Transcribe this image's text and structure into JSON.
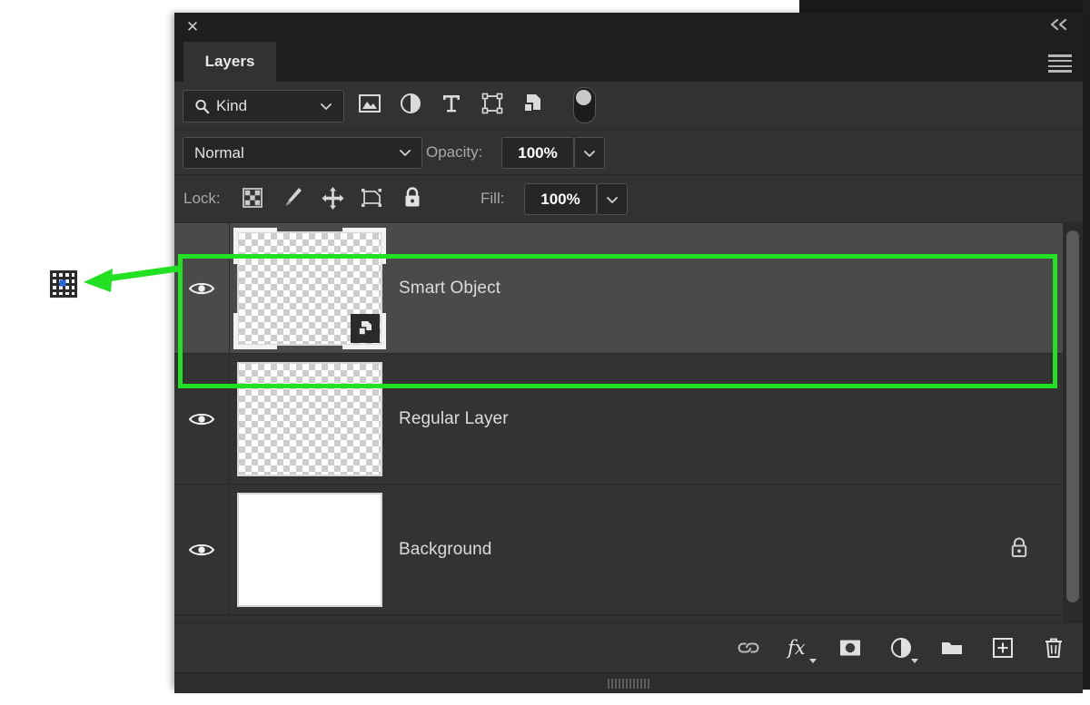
{
  "panel": {
    "title": "Layers",
    "close_label": "✕",
    "collapse_label": "«",
    "menu_icon": "hamburger-menu-icon"
  },
  "filter": {
    "kind_label": "Kind",
    "search_icon": "search-icon",
    "caret_icon": "chevron-down-icon",
    "icons": [
      {
        "name": "filter-pixel-layers-icon",
        "title": "Pixel Layers"
      },
      {
        "name": "filter-adjustment-layers-icon",
        "title": "Adjustment Layers"
      },
      {
        "name": "filter-type-layers-icon",
        "title": "Type Layers"
      },
      {
        "name": "filter-shape-layers-icon",
        "title": "Shape Layers"
      },
      {
        "name": "filter-smart-object-layers-icon",
        "title": "Smart Objects"
      }
    ],
    "toggle_name": "filter-enable-toggle"
  },
  "blend": {
    "mode": "Normal",
    "opacity_label": "Opacity:",
    "opacity_value": "100%",
    "caret_icon": "chevron-down-icon"
  },
  "lock": {
    "label": "Lock:",
    "fill_label": "Fill:",
    "fill_value": "100%",
    "icons": [
      {
        "name": "lock-transparent-pixels-icon"
      },
      {
        "name": "lock-image-pixels-icon"
      },
      {
        "name": "lock-position-icon"
      },
      {
        "name": "lock-artboard-nesting-icon"
      },
      {
        "name": "lock-all-icon"
      }
    ]
  },
  "layers": [
    {
      "name": "Smart Object",
      "visible": true,
      "selected": true,
      "thumb": "checker",
      "badge": "smart-object-badge-icon",
      "locked": false
    },
    {
      "name": "Regular Layer",
      "visible": true,
      "selected": false,
      "thumb": "checker",
      "badge": null,
      "locked": false
    },
    {
      "name": "Background",
      "visible": true,
      "selected": false,
      "thumb": "white",
      "badge": null,
      "locked": true
    }
  ],
  "bottom_toolbar": [
    {
      "name": "link-layers-icon",
      "has_caret": false
    },
    {
      "name": "layer-style-fx-icon",
      "has_caret": true
    },
    {
      "name": "add-layer-mask-icon",
      "has_caret": false
    },
    {
      "name": "new-adjustment-layer-icon",
      "has_caret": true
    },
    {
      "name": "new-group-icon",
      "has_caret": false
    },
    {
      "name": "new-layer-icon",
      "has_caret": false
    },
    {
      "name": "delete-layer-icon",
      "has_caret": false
    }
  ],
  "annotation": {
    "highlight_color": "#22e022",
    "arrow_color": "#22e022",
    "callout_icon": "smart-object-grid-icon"
  }
}
